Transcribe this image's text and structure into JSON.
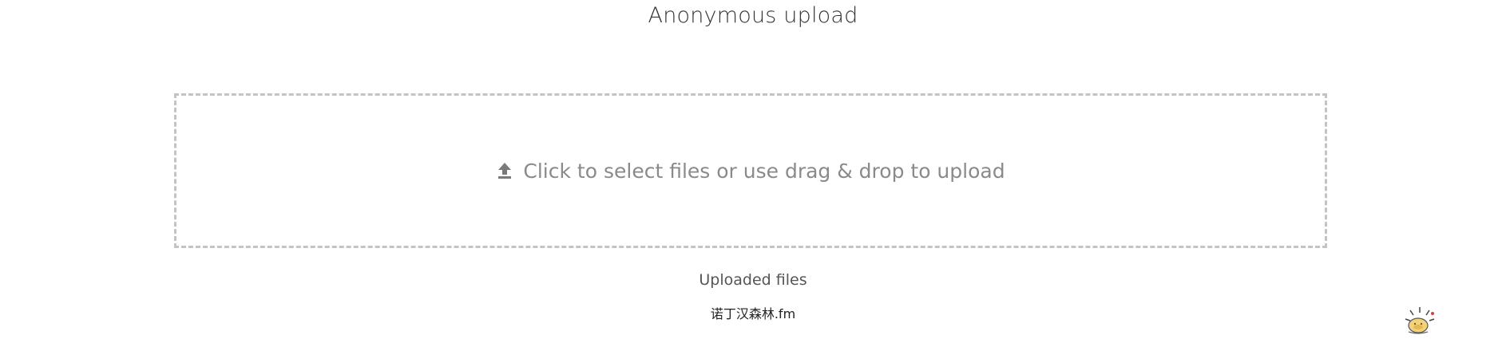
{
  "header": {
    "title": "Anonymous upload"
  },
  "dropzone": {
    "icon": "upload-icon",
    "label": "Click to select files or use drag & drop to upload"
  },
  "uploaded": {
    "heading": "Uploaded files",
    "files": [
      {
        "name": "诺丁汉森林.fm"
      }
    ]
  },
  "widget": {
    "icon": "sun-mascot-icon"
  },
  "colors": {
    "border": "#c4c4c4",
    "hint_text": "#8a8a8a",
    "title_text": "#333333"
  }
}
